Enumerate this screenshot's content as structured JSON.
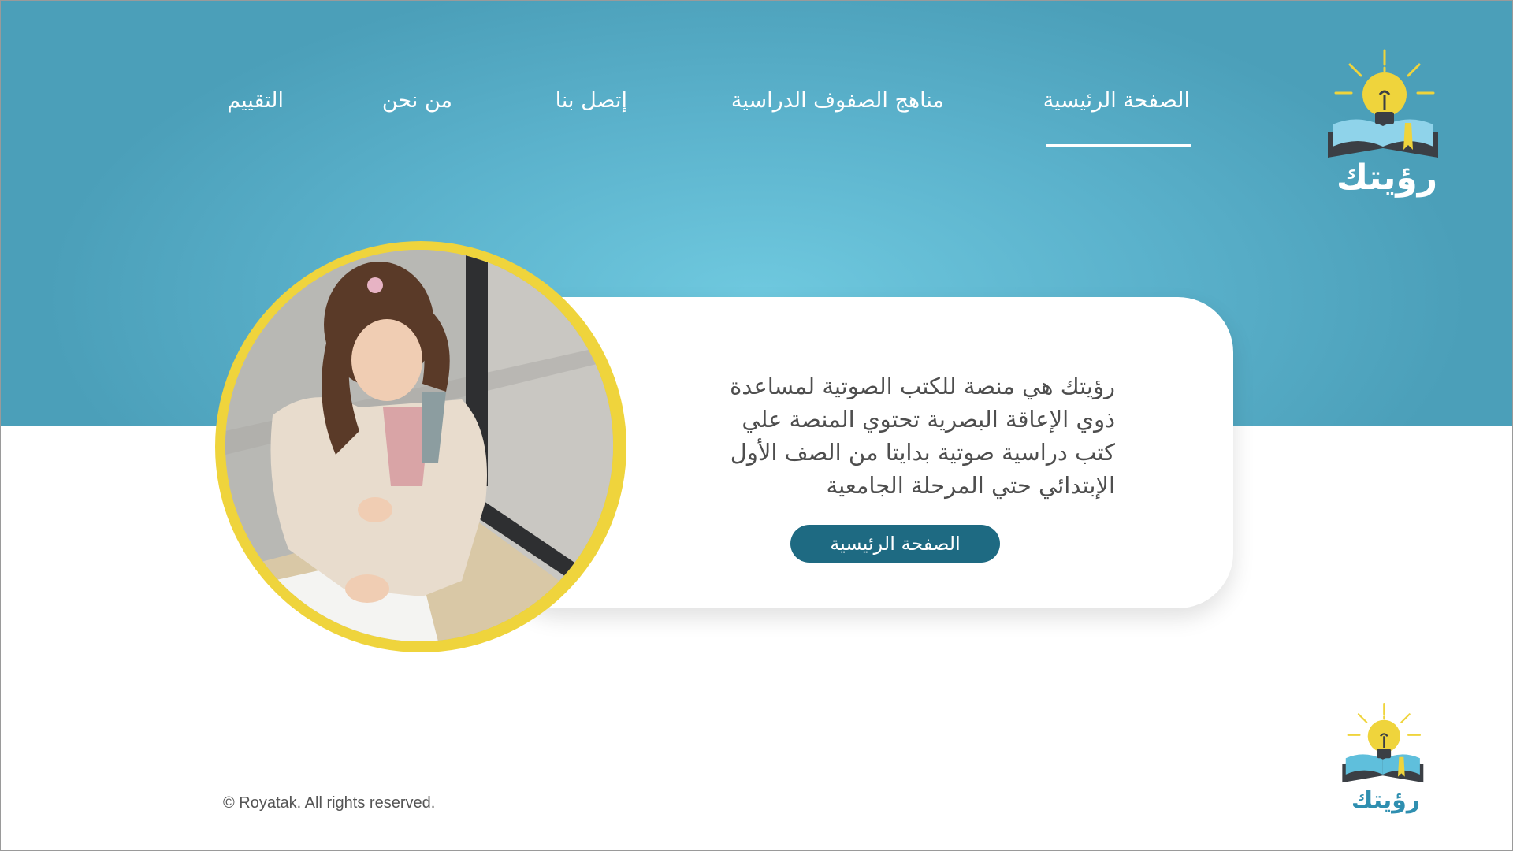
{
  "brand": {
    "logo_text": "رؤيتك",
    "colors": {
      "primary": "#1e6a82",
      "accent": "#efd43c",
      "hero": "#5bb2cc"
    }
  },
  "nav": {
    "items": [
      {
        "label": "الصفحة الرئيسية",
        "active": true
      },
      {
        "label": "مناهج الصفوف الدراسية",
        "active": false
      },
      {
        "label": "إتصل بنا",
        "active": false
      },
      {
        "label": "من نحن",
        "active": false
      },
      {
        "label": "التقييم",
        "active": false
      }
    ]
  },
  "hero": {
    "description_lines": [
      "رؤيتك هي منصة للكتب الصوتية لمساعدة",
      "ذوي الإعاقة البصرية  تحتوي المنصة علي",
      "كتب دراسية صوتية بدايتا من الصف الأول",
      "الإبتدائي حتي المرحلة الجامعية"
    ],
    "button_label": "الصفحة الرئيسية",
    "image_icon": "girl-reading-photo"
  },
  "footer": {
    "copyright": "© Royatak. All rights reserved.",
    "logo_text": "رؤيتك"
  }
}
